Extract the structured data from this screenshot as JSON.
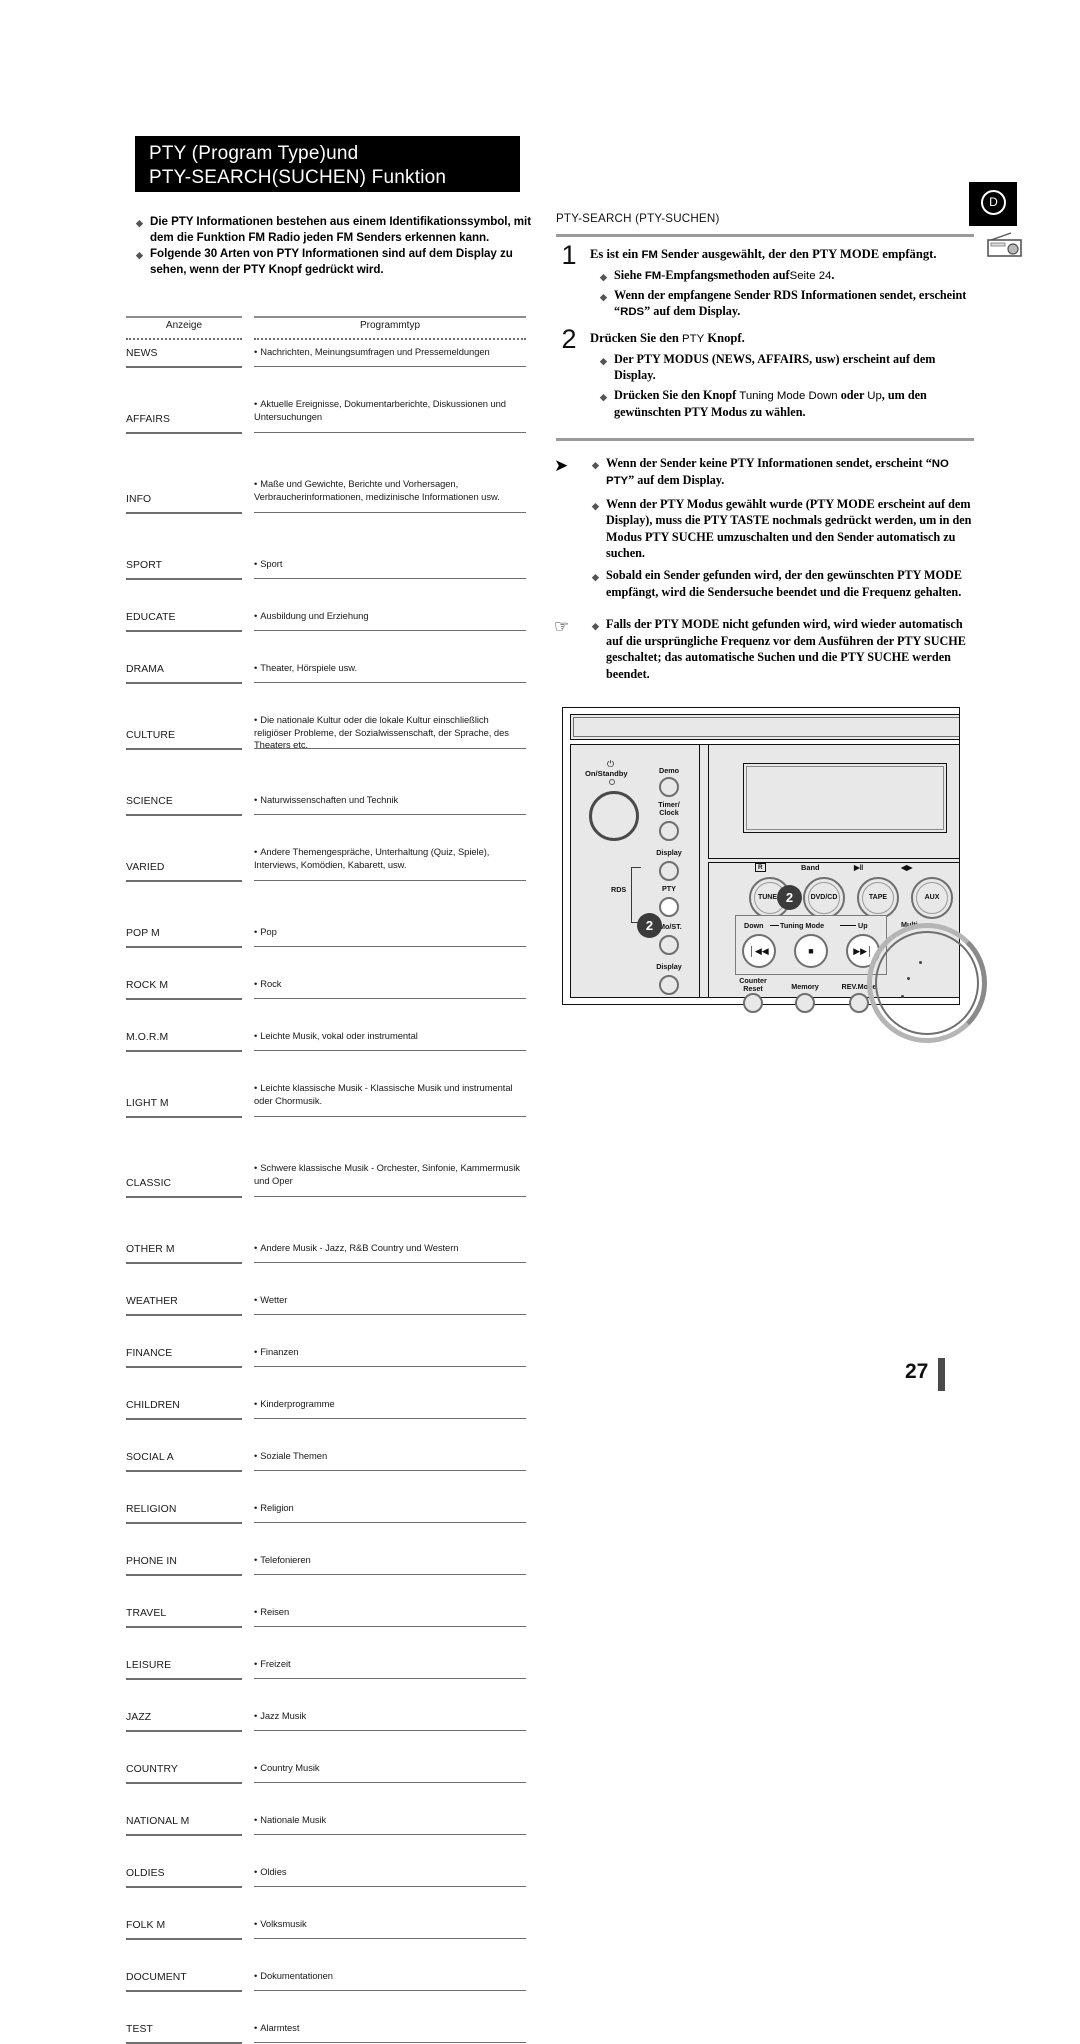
{
  "header": {
    "title_line1": "PTY (Program Type)und",
    "title_line2": "PTY-SEARCH(SUCHEN) Funktion"
  },
  "intro_bullets": [
    "Die PTY Informationen bestehen aus einem Identifikationssymbol, mit dem die Funktion FM Radio jeden FM Senders erkennen kann.",
    "Folgende 30 Arten von PTY Informationen sind auf dem Display zu sehen, wenn der PTY Knopf gedrückt wird."
  ],
  "table": {
    "header_display": "Anzeige",
    "header_type": "Programmtyp",
    "rows": [
      {
        "code": "NEWS",
        "desc": "Nachrichten, Meinungsumfragen und Pressemeldungen"
      },
      {
        "code": "AFFAIRS",
        "desc": "Aktuelle Ereignisse, Dokumentarberichte, Diskussionen und Untersuchungen"
      },
      {
        "code": "INFO",
        "desc": "Maße und Gewichte, Berichte und Vorhersagen, Verbraucherinformationen, medizinische Informationen usw."
      },
      {
        "code": "SPORT",
        "desc": "Sport"
      },
      {
        "code": "EDUCATE",
        "desc": "Ausbildung und Erziehung"
      },
      {
        "code": "DRAMA",
        "desc": "Theater, Hörspiele usw."
      },
      {
        "code": "CULTURE",
        "desc": "Die nationale Kultur oder die lokale Kultur einschließlich religiöser Probleme, der Sozialwissenschaft, der Sprache, des Theaters etc."
      },
      {
        "code": "SCIENCE",
        "desc": "Naturwissenschaften und Technik"
      },
      {
        "code": "VARIED",
        "desc": "Andere Themengespräche, Unterhaltung (Quiz, Spiele), Interviews, Komödien, Kabarett, usw."
      },
      {
        "code": "POP M",
        "desc": "Pop"
      },
      {
        "code": "ROCK M",
        "desc": "Rock"
      },
      {
        "code": "M.O.R.M",
        "desc": "Leichte Musik, vokal oder instrumental"
      },
      {
        "code": "LIGHT M",
        "desc": "Leichte klassische Musik - Klassische Musik und instrumental oder Chormusik."
      },
      {
        "code": "CLASSIC",
        "desc": "Schwere klassische Musik - Orchester, Sinfonie, Kammermusik und Oper"
      },
      {
        "code": "OTHER M",
        "desc": "Andere Musik - Jazz, R&B Country und Western"
      },
      {
        "code": "WEATHER",
        "desc": "Wetter"
      },
      {
        "code": "FINANCE",
        "desc": "Finanzen"
      },
      {
        "code": "CHILDREN",
        "desc": "Kinderprogramme"
      },
      {
        "code": "SOCIAL A",
        "desc": "Soziale Themen"
      },
      {
        "code": "RELIGION",
        "desc": "Religion"
      },
      {
        "code": "PHONE IN",
        "desc": "Telefonieren"
      },
      {
        "code": "TRAVEL",
        "desc": "Reisen"
      },
      {
        "code": "LEISURE",
        "desc": "Freizeit"
      },
      {
        "code": "JAZZ",
        "desc": "Jazz Musik"
      },
      {
        "code": "COUNTRY",
        "desc": "Country Musik"
      },
      {
        "code": "NATIONAL M",
        "desc": "Nationale Musik"
      },
      {
        "code": "OLDIES",
        "desc": "Oldies"
      },
      {
        "code": "FOLK M",
        "desc": "Volksmusik"
      },
      {
        "code": "DOCUMENT",
        "desc": "Dokumentationen"
      },
      {
        "code": "TEST",
        "desc": "Alarmtest"
      }
    ]
  },
  "right": {
    "section_title": "PTY-SEARCH (PTY-SUCHEN)",
    "step1": {
      "num": "1",
      "head_a": "Es ist ein ",
      "head_fm": "FM",
      "head_b": " Sender ausgewählt, der den PTY MODE empfängt.",
      "subs": [
        {
          "a": "Siehe ",
          "fm": "FM",
          "b": "-Empfangsmethoden auf",
          "page_ref": "Seite 24",
          "c": "."
        },
        {
          "a": "Wenn der empfangene Sender RDS Informationen sendet, erscheint “",
          "rds": "RDS",
          "b": "” auf dem Display."
        }
      ]
    },
    "step2": {
      "num": "2",
      "head_a": "Drücken Sie den ",
      "head_btn": "PTY",
      "head_b": " Knopf.",
      "subs": [
        "Der PTY MODUS (NEWS, AFFAIRS, usw) erscheint auf dem Display.",
        {
          "a": "Drücken Sie den Knopf ",
          "btn": "Tuning Mode Down",
          "b": " oder ",
          "btn2": "Up",
          "c": ", um den gewünschten PTY Modus zu wählen."
        }
      ]
    },
    "note_arrow": {
      "glyph": "arrow-head-icon",
      "items": [
        {
          "a": "Wenn der Sender keine PTY Informationen sendet, erscheint “",
          "disp": "NO PTY",
          "b": "” auf dem Display."
        },
        "Wenn der PTY Modus gewählt wurde (PTY MODE erscheint auf dem Display), muss die PTY TASTE nochmals gedrückt werden, um in den Modus PTY SUCHE umzuschalten und den Sender automatisch zu suchen.",
        "Sobald ein Sender gefunden wird, der den gewünschten PTY MODE empfängt, wird die Sendersuche beendet und die Frequenz gehalten."
      ]
    },
    "note_hand": {
      "glyph": "pointing-hand-icon",
      "items": [
        "Falls der PTY MODE nicht gefunden wird, wird wieder automatisch auf die ursprüngliche Frequenz vor dem Ausführen der PTY SUCHE geschaltet; das automatische Suchen und die PTY SUCHE werden beendet."
      ]
    }
  },
  "corner": {
    "chapter_letter": "D",
    "radio_icon": "radio-tuner-icon"
  },
  "device": {
    "power_label": "On/Standby",
    "left_buttons": [
      {
        "label": "Demo"
      },
      {
        "label": "Timer/\nClock"
      },
      {
        "label": "Display"
      },
      {
        "label": "PTY",
        "highlight": true
      },
      {
        "label": "Mo/ST."
      },
      {
        "label": "Display"
      }
    ],
    "rds_bracket_label": "RDS",
    "display_row_labels": [
      "Band"
    ],
    "remote_icon": "remote-sensor-icon",
    "play_pause_icon": "▶‖",
    "skip_icon": "◀▶",
    "source_knobs": [
      "TUNER",
      "DVD/CD",
      "TAPE",
      "AUX"
    ],
    "tuning_group": {
      "down": "Down",
      "title": "Tuning Mode",
      "up": "Up",
      "prev_icon": "│◀◀",
      "stop_icon": "■",
      "next_icon": "▶▶│"
    },
    "bottom_buttons": [
      "Counter\nReset",
      "Memory",
      "REV.Mode"
    ],
    "multi_label": "Multi",
    "callout_number": "2"
  },
  "footer": {
    "page_number": "27"
  }
}
